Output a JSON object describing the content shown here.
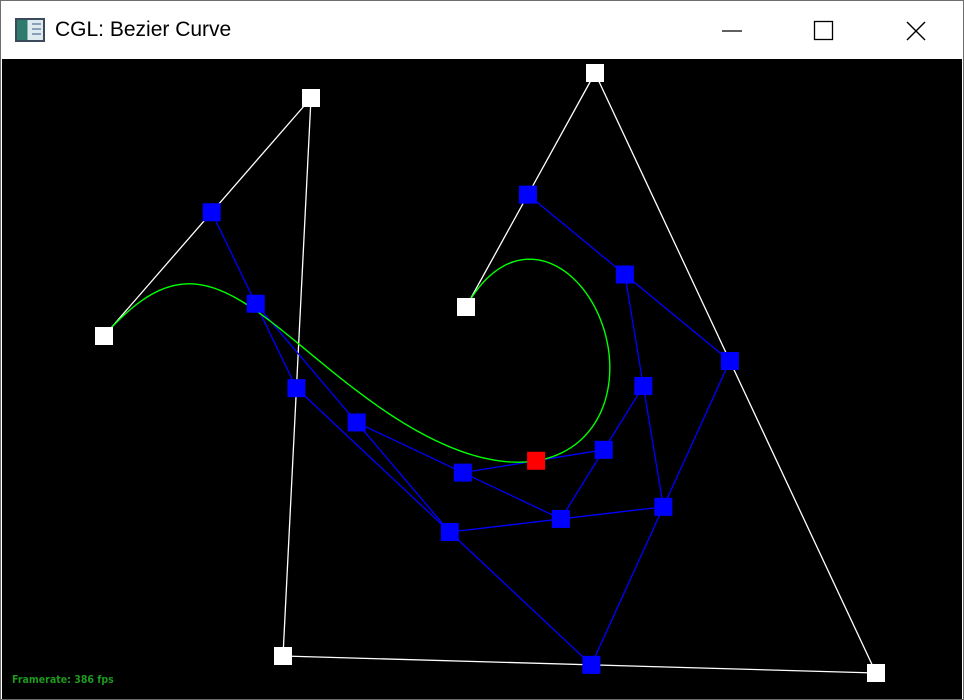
{
  "window": {
    "title": "CGL: Bezier Curve",
    "icons": {
      "app": "app-window-icon",
      "minimize": "minimize-icon",
      "maximize": "maximize-icon",
      "close": "close-icon"
    }
  },
  "status": {
    "framerate_text": "Framerate: 386 fps"
  },
  "colors": {
    "background": "#000000",
    "control_polygon": "#ffffff",
    "control_point": "#ffffff",
    "de_casteljau_lines": "#0000ff",
    "de_casteljau_points": "#0000ff",
    "curve": "#00ff00",
    "curve_point": "#ff0000",
    "framerate_text": "#1e9a1e"
  },
  "bezier": {
    "t": 0.52
  }
}
